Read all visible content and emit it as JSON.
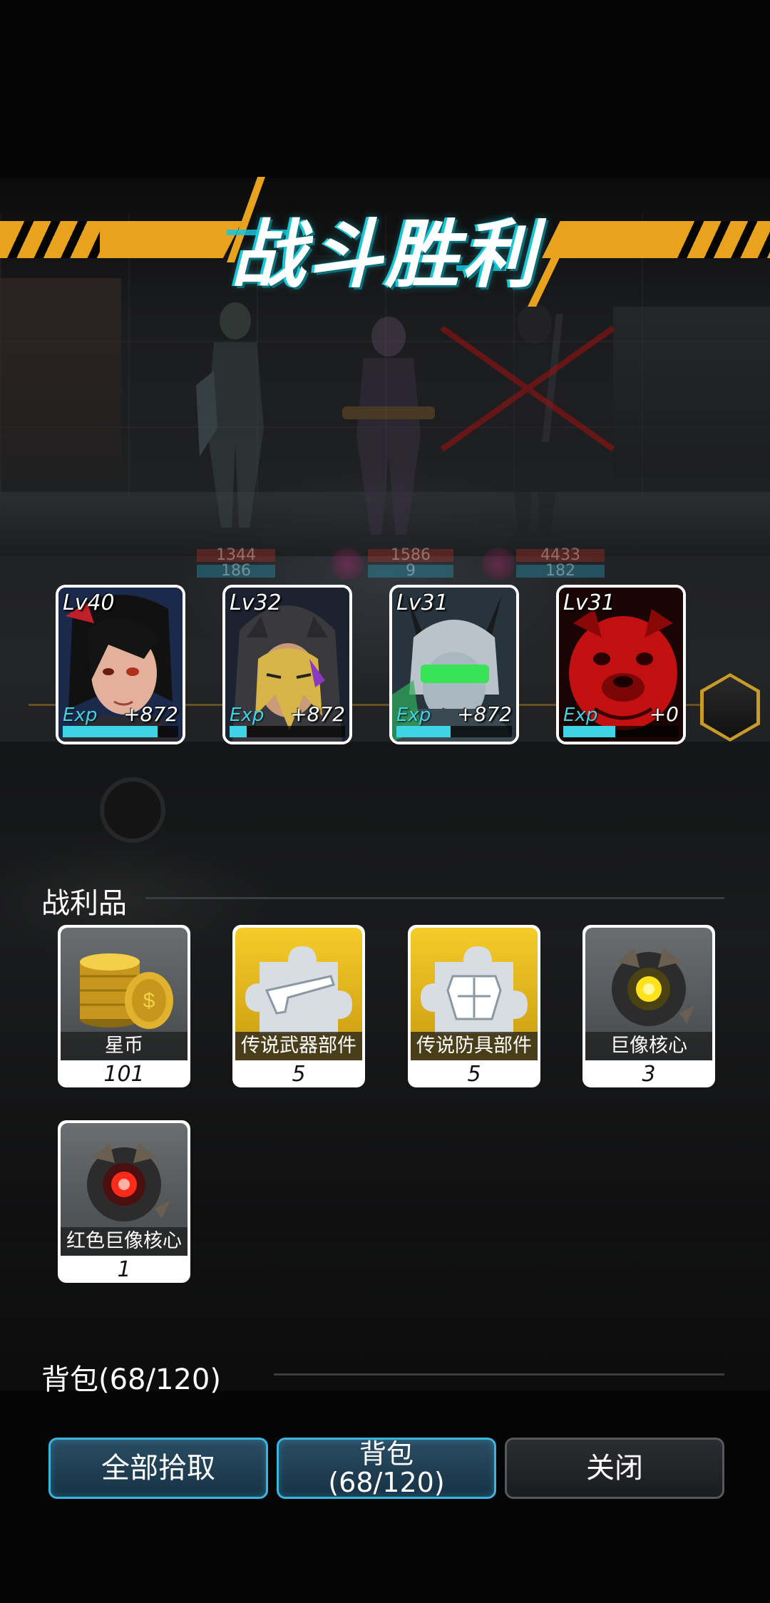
{
  "title": "战斗胜利",
  "colors": {
    "banner": "#e8a21e",
    "exp_bar": "#3fd3e6",
    "legendary": "#f0c020",
    "button_border_blue": "#3cb4de"
  },
  "hud": {
    "hp_values": [
      "1344",
      "1586",
      "4433"
    ],
    "mp_values": [
      "186",
      "9",
      "182"
    ]
  },
  "heroes": [
    {
      "level": "Lv40",
      "exp_label": "Exp",
      "exp_gain": "+872",
      "exp_progress": 0.82,
      "portrait": "black-haired-woman"
    },
    {
      "level": "Lv32",
      "exp_label": "Exp",
      "exp_gain": "+872",
      "exp_progress": 0.15,
      "portrait": "hooded-blonde-woman"
    },
    {
      "level": "Lv31",
      "exp_label": "Exp",
      "exp_gain": "+872",
      "exp_progress": 0.47,
      "portrait": "horned-visor-warrior"
    },
    {
      "level": "Lv31",
      "exp_label": "Exp",
      "exp_gain": "+0",
      "exp_progress": 0.45,
      "portrait": "red-bulldog"
    }
  ],
  "loot_section": {
    "title": "战利品"
  },
  "loot": [
    {
      "name": "星币",
      "count": "101",
      "rarity": "gray",
      "icon": "coin-stack-icon"
    },
    {
      "name": "传说武器部件",
      "count": "5",
      "rarity": "gold",
      "icon": "weapon-part-icon"
    },
    {
      "name": "传说防具部件",
      "count": "5",
      "rarity": "gold",
      "icon": "armor-part-icon"
    },
    {
      "name": "巨像核心",
      "count": "3",
      "rarity": "gray",
      "icon": "colossus-core-icon"
    },
    {
      "name": "红色巨像核心",
      "count": "1",
      "rarity": "gray",
      "icon": "red-colossus-core-icon"
    }
  ],
  "backpack_section": {
    "title": "背包(68/120)"
  },
  "buttons": {
    "pick_all": "全部拾取",
    "backpack_line1": "背包",
    "backpack_line2": "(68/120)",
    "close": "关闭"
  }
}
